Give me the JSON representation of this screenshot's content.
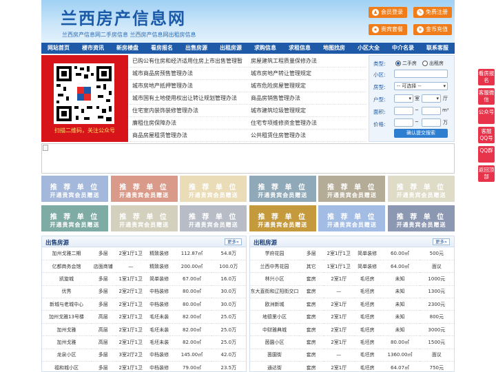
{
  "header": {
    "title": "兰西房产信息网",
    "subtitle": "兰西房产信息网二手房信息   兰西房产信息网出租房信息",
    "buttons": [
      {
        "label": "会员登录",
        "icon": "user-icon"
      },
      {
        "label": "免费注册",
        "icon": "register-icon"
      },
      {
        "label": "贵宾套餐",
        "icon": "vip-icon"
      },
      {
        "label": "金币充值",
        "icon": "coin-icon"
      }
    ]
  },
  "nav": [
    "网站首页",
    "楼市资讯",
    "新房楼盘",
    "看房报名",
    "出售房源",
    "出租房源",
    "求购信息",
    "求租信息",
    "地图找房",
    "小区大全",
    "中介名录",
    "联系客服"
  ],
  "qr": {
    "caption": "扫描二维码，关注公众号"
  },
  "links": [
    [
      "已购公有住房和经济适用住房上市出售管理暂",
      "房屋建筑工程质量保修办法"
    ],
    [
      "城市商品房预售管理办法",
      "城市房地产转让管理规定"
    ],
    [
      "城市房地产抵押管理办法",
      "城市危险房屋管理规定"
    ],
    [
      "城市国有土地使用权出让转让规划管理办法",
      "商品房销售管理办法"
    ],
    [
      "住宅室内装饰装修管理办法",
      "城市建筑垃圾管理规定"
    ],
    [
      "廉租住房保障办法",
      "住宅专项维修资金管理办法"
    ],
    [
      "商品房屋租赁管理办法",
      "公共租赁住房管理办法"
    ]
  ],
  "search": {
    "type_label": "类型:",
    "type_opt1": "二手房",
    "type_opt2": "出租房",
    "community_label": "小区:",
    "house_label": "房型:",
    "house_value": "-- 可选择 --",
    "room_label": "户型:",
    "room_unit1": "室",
    "room_unit2": "厅",
    "area_label": "面积:",
    "area_sep": "~",
    "area_unit": "m²",
    "price_label": "价格:",
    "price_sep": "~",
    "price_unit": "万",
    "submit": "确认提交搜索"
  },
  "ads": {
    "line1": "推 荐 单 位",
    "line2": "开通贵宾会员赠送",
    "colors": [
      "#a4b8dc",
      "#d99a8a",
      "#e9dcb7",
      "#8fa9b8",
      "#b4ac96",
      "#dedbc6",
      "#7eaba4",
      "#d3d1bd",
      "#b7bcc7",
      "#c49a3c",
      "#a3bce4",
      "#8c97b2"
    ]
  },
  "sale": {
    "title": "出售房源",
    "more": "更多»",
    "rows": [
      [
        "加州戈雅二期",
        "多层",
        "2室1厅1卫",
        "精致装修",
        "112.87㎡",
        "54.8万"
      ],
      [
        "亿都商务会馆",
        "店面商铺",
        "—",
        "精致装修",
        "200.00㎡",
        "100.0万"
      ],
      [
        "凯旋城",
        "多层",
        "1室1厅1卫",
        "简单装修",
        "67.00㎡",
        "16.0万"
      ],
      [
        "优秀",
        "多层",
        "2室2厅1卫",
        "中档装修",
        "80.00㎡",
        "30.0万"
      ],
      [
        "新城与老城中心",
        "多层",
        "2室1厅1卫",
        "中档装修",
        "80.00㎡",
        "30.0万"
      ],
      [
        "加州戈雅13号楼",
        "高层",
        "2室1厅1卫",
        "毛坯未装",
        "82.00㎡",
        "25.0万"
      ],
      [
        "加州戈雅",
        "高层",
        "2室1厅1卫",
        "毛坯未装",
        "82.00㎡",
        "25.0万"
      ],
      [
        "加州戈雅",
        "高层",
        "2室1厅1卫",
        "毛坯未装",
        "82.00㎡",
        "25.0万"
      ],
      [
        "龙泉小区",
        "多层",
        "3室2厅2卫",
        "中档装修",
        "145.00㎡",
        "42.0万"
      ],
      [
        "福和城小区",
        "多层",
        "2室1厅1卫",
        "中档装修",
        "79.00㎡",
        "23.5万"
      ]
    ]
  },
  "rent": {
    "title": "出租房源",
    "more": "更多»",
    "rows": [
      [
        "学府花园",
        "多层",
        "2室1厅1卫",
        "简单装修",
        "60.00㎡",
        "500元"
      ],
      [
        "兰西中秀花园",
        "其它",
        "1室1厅1卫",
        "简单装修",
        "64.00㎡",
        "面议"
      ],
      [
        "林兴小区",
        "套房",
        "2室1厅",
        "毛坯房",
        "未知",
        "1000元"
      ],
      [
        "东大直街和辽阳街交口",
        "套房",
        "—",
        "毛坯房",
        "未知",
        "1300元"
      ],
      [
        "欧洲新城",
        "套房",
        "2室1厅",
        "毛坯房",
        "未知",
        "2300元"
      ],
      [
        "地德里小区",
        "套房",
        "2室1厅",
        "毛坯房",
        "未知",
        "800元"
      ],
      [
        "中财雅典城",
        "套房",
        "2室1厅",
        "毛坯房",
        "未知",
        "3000元"
      ],
      [
        "茵園小区",
        "套房",
        "2室1厅",
        "毛坯房",
        "80.00㎡",
        "1500元"
      ],
      [
        "茵園街",
        "套房",
        "—",
        "毛坯房",
        "1360.00㎡",
        "面议"
      ],
      [
        "通达街",
        "套房",
        "2室1厅",
        "毛坯房",
        "64.07㎡",
        "750元"
      ]
    ]
  },
  "float": [
    "看房报名",
    "客服微信",
    "公众号",
    "客服QQ号",
    "QQ群",
    "返回顶部"
  ]
}
